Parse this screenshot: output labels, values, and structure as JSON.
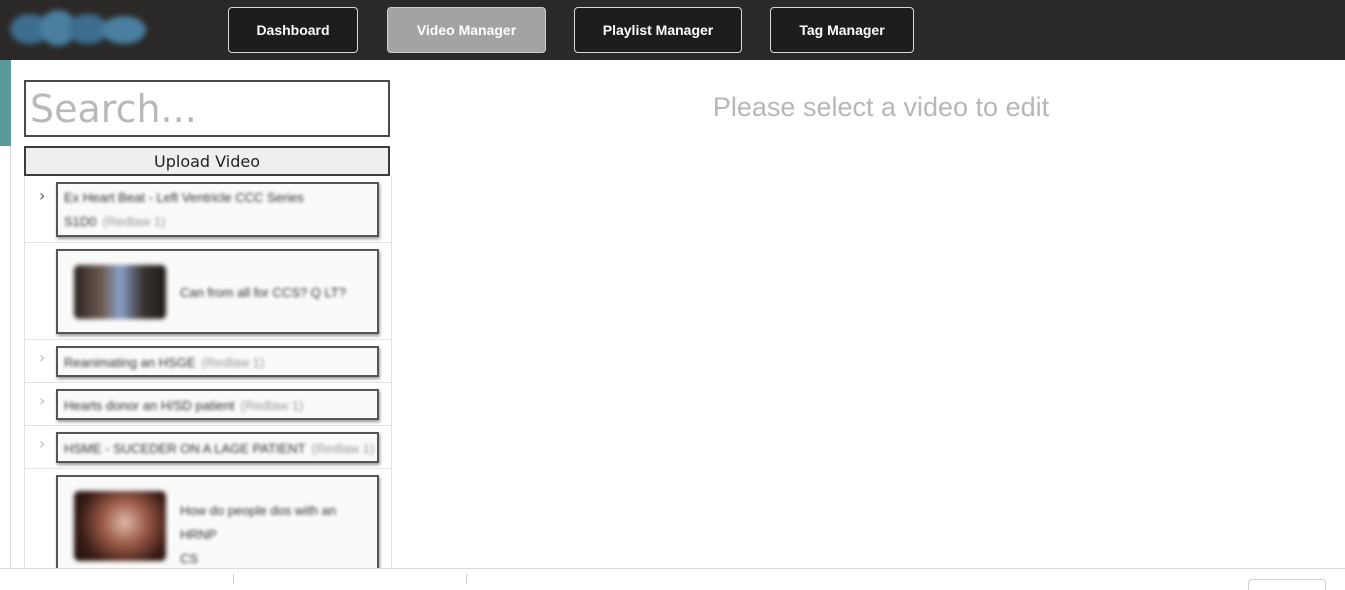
{
  "nav": {
    "logo_icon": "logo-icon",
    "tabs": [
      {
        "label": "Dashboard",
        "active": false
      },
      {
        "label": "Video Manager",
        "active": true
      },
      {
        "label": "Playlist Manager",
        "active": false
      },
      {
        "label": "Tag Manager",
        "active": false
      }
    ]
  },
  "sidebar": {
    "search_placeholder": "Search...",
    "upload_label": "Upload Video",
    "items": [
      {
        "type": "group",
        "title": "Ex Heart Beat - Left Ventricle CCC Series",
        "title2": "S1D0",
        "sub": "(Redlaw 1)"
      },
      {
        "type": "video",
        "title": "Can from all for CCS? Q LT?"
      },
      {
        "type": "group",
        "title": "Reanimating an HSGE",
        "sub": "(Redlaw 1)"
      },
      {
        "type": "group",
        "title": "Hearts donor an H/SD patient",
        "sub": "(Redlaw 1)"
      },
      {
        "type": "group",
        "title": "HSME - SUCEDER ON A LAGE PATIENT",
        "sub": "(Redlaw 1)"
      },
      {
        "type": "video",
        "title": "How do people dos with an HRNP",
        "title2": "CS"
      }
    ]
  },
  "main": {
    "empty_message": "Please select a video to edit"
  },
  "colors": {
    "topbar": "#2b2927",
    "active_tab": "#a3a3a3",
    "accent": "#5b9a9b"
  }
}
